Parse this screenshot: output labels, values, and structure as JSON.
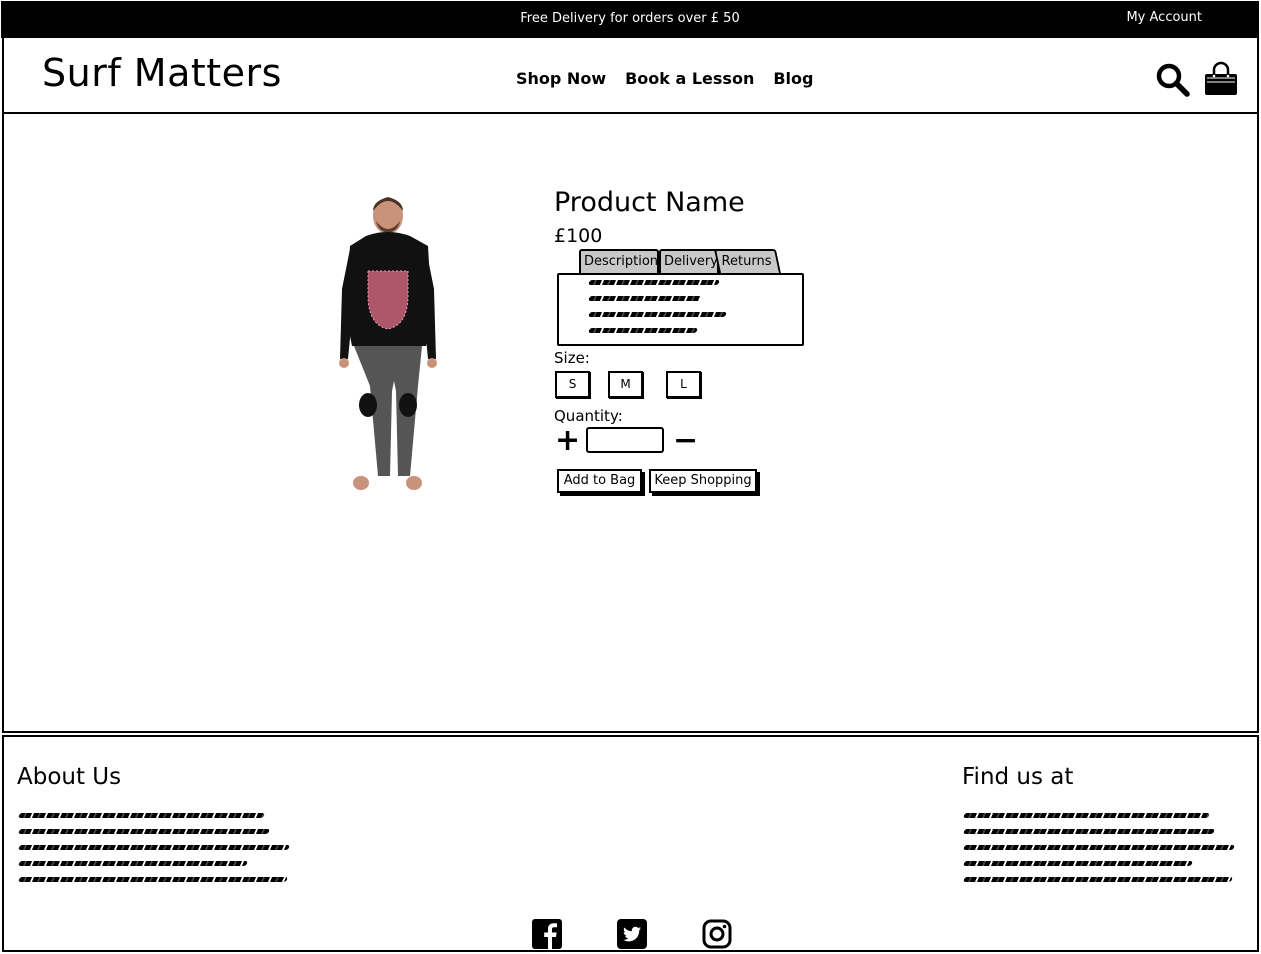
{
  "topbar": {
    "promo": "Free Delivery for orders over £ 50",
    "account": "My Account"
  },
  "header": {
    "logo": "Surf Matters",
    "nav": [
      "Shop Now",
      "Book a Lesson",
      "Blog"
    ],
    "icons": [
      "search-icon",
      "shopping-bag-icon"
    ]
  },
  "product": {
    "image": "wetsuit-model-image",
    "name": "Product Name",
    "price": "£100",
    "tabs": [
      "Description",
      "Delivery",
      "Returns"
    ],
    "size_label": "Size:",
    "sizes": [
      "S",
      "M",
      "L"
    ],
    "quantity_label": "Quantity:",
    "quantity_plus": "+",
    "quantity_minus": "−",
    "quantity_value": "",
    "add_to_bag": "Add to Bag",
    "keep_shopping": "Keep Shopping"
  },
  "footer": {
    "about_title": "About Us",
    "find_title": "Find us at",
    "social_icons": [
      "facebook-icon",
      "twitter-icon",
      "instagram-icon"
    ]
  }
}
